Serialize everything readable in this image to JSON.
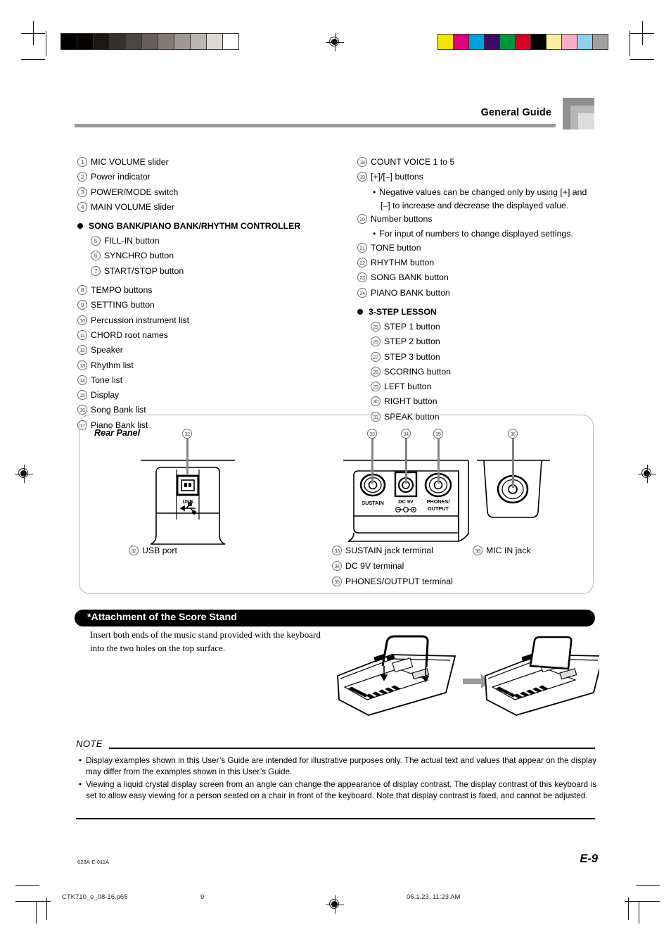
{
  "header": {
    "title": "General Guide"
  },
  "left_column": [
    {
      "num": "1",
      "label": "MIC VOLUME slider",
      "indent": false
    },
    {
      "num": "2",
      "label": "Power indicator",
      "indent": false
    },
    {
      "num": "3",
      "label": "POWER/MODE switch",
      "indent": false
    },
    {
      "num": "4",
      "label": "MAIN VOLUME slider",
      "indent": false
    }
  ],
  "left_group": {
    "heading": "SONG BANK/PIANO BANK/RHYTHM CONTROLLER",
    "items": [
      {
        "num": "5",
        "label": "FILL-IN button"
      },
      {
        "num": "6",
        "label": "SYNCHRO button"
      },
      {
        "num": "7",
        "label": "START/STOP button"
      }
    ]
  },
  "left_column_2": [
    {
      "num": "8",
      "label": "TEMPO buttons"
    },
    {
      "num": "9",
      "label": "SETTING button"
    },
    {
      "num": "10",
      "label": "Percussion instrument list"
    },
    {
      "num": "11",
      "label": "CHORD root names"
    },
    {
      "num": "12",
      "label": "Speaker"
    },
    {
      "num": "13",
      "label": "Rhythm list"
    },
    {
      "num": "14",
      "label": "Tone list"
    },
    {
      "num": "15",
      "label": "Display"
    },
    {
      "num": "16",
      "label": "Song Bank list"
    },
    {
      "num": "17",
      "label": "Piano Bank list"
    }
  ],
  "right_column": [
    {
      "num": "18",
      "label": "COUNT VOICE 1 to 5"
    },
    {
      "num": "19",
      "label": "[+]/[–] buttons"
    }
  ],
  "right_sub_1": {
    "dot": "•",
    "line1": "Negative values can be changed only by using [+] and",
    "line2": "[–] to increase and decrease the displayed value."
  },
  "right_column_2": [
    {
      "num": "20",
      "label": "Number buttons"
    }
  ],
  "right_sub_2": {
    "dot": "•",
    "line1": "For input of numbers to change displayed settings."
  },
  "right_column_3": [
    {
      "num": "21",
      "label": "TONE button"
    },
    {
      "num": "22",
      "label": "RHYTHM button"
    },
    {
      "num": "23",
      "label": "SONG BANK button"
    },
    {
      "num": "24",
      "label": "PIANO BANK button"
    }
  ],
  "right_group": {
    "heading": "3-STEP LESSON",
    "items": [
      {
        "num": "25",
        "label": "STEP 1 button"
      },
      {
        "num": "26",
        "label": "STEP 2 button"
      },
      {
        "num": "27",
        "label": "STEP 3 button"
      },
      {
        "num": "28",
        "label": "SCORING button"
      },
      {
        "num": "29",
        "label": "LEFT button"
      },
      {
        "num": "30",
        "label": "RIGHT button"
      },
      {
        "num": "31",
        "label": "SPEAK button"
      }
    ]
  },
  "rear_panel": {
    "title": "Rear Panel",
    "callouts": [
      {
        "num": "32"
      },
      {
        "num": "33"
      },
      {
        "num": "34"
      },
      {
        "num": "35"
      },
      {
        "num": "36"
      }
    ],
    "jack_labels": {
      "usb": "USB",
      "sustain": "SUSTAIN",
      "dc9v": "DC 9V",
      "phones_line1": "PHONES/",
      "phones_line2": "OUTPUT"
    },
    "legend_left": [
      {
        "num": "32",
        "label": "USB port"
      }
    ],
    "legend_mid": [
      {
        "num": "33",
        "label": "SUSTAIN jack terminal"
      },
      {
        "num": "34",
        "label": "DC 9V terminal"
      },
      {
        "num": "35",
        "label": "PHONES/OUTPUT terminal"
      }
    ],
    "legend_right": [
      {
        "num": "36",
        "label": "MIC IN jack"
      }
    ]
  },
  "score_stand": {
    "band_title": "*Attachment of the Score Stand",
    "description": "Insert both ends of the music stand provided with the keyboard into the two holes on the top surface."
  },
  "note": {
    "label": "NOTE",
    "items": [
      {
        "dot": "•",
        "text": "Display examples shown in this User’s Guide are intended for illustrative purposes only. The actual text and values that appear on the display may differ from the examples shown in this User’s Guide."
      },
      {
        "dot": "•",
        "text": "Viewing a liquid crystal display screen from an angle can change the appearance of display contrast. The display contrast of this keyboard is set to allow easy viewing for a person seated on a chair in front of the keyboard. Note that display contrast is fixed, and cannot be adjusted."
      }
    ]
  },
  "footer": {
    "doc_code": "628A-E-011A",
    "page_number": "E-9",
    "print_file": "CTK710_e_08-16.p65",
    "print_page": "9",
    "print_date": "06.1.23, 11:23 AM"
  },
  "print_marks": {
    "grayscale_swatches": [
      "#000000",
      "#060403",
      "#1d1813",
      "#37302b",
      "#4e453f",
      "#6a5f58",
      "#857a72",
      "#a09891",
      "#bdb6b0",
      "#ded9d3",
      "#ffffff"
    ],
    "color_swatches": [
      "#f2e500",
      "#e0007a",
      "#00a0e0",
      "#3b0a6b",
      "#00953f",
      "#d80028",
      "#000000",
      "#f8f0a0",
      "#f5acc4",
      "#8fd0f0",
      "#a0a0a0"
    ]
  }
}
